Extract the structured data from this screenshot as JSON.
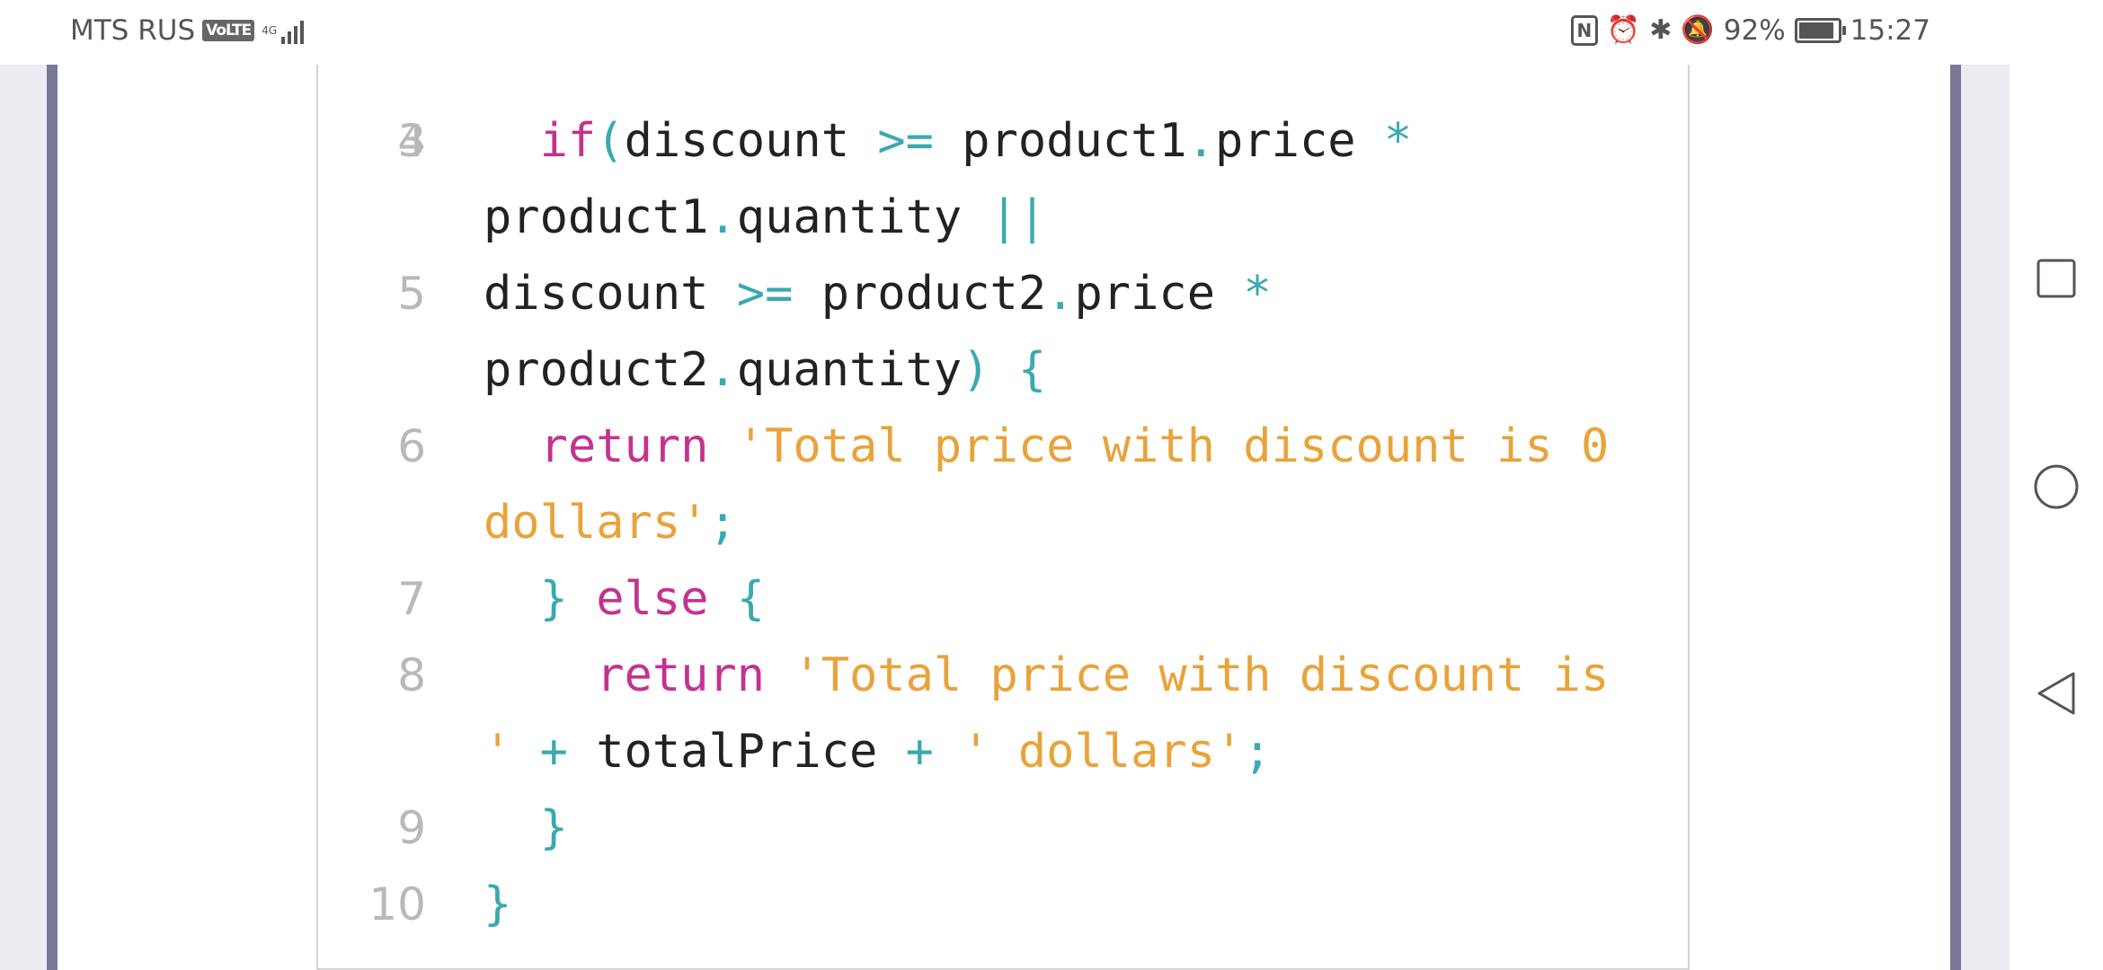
{
  "status_bar": {
    "carrier": "MTS RUS",
    "volte": "VoLTE",
    "network": "4G",
    "battery": "92%",
    "battery_level": 0.92,
    "time": "15:27"
  },
  "code": {
    "partial_line_number": "3",
    "lines": [
      {
        "num": "4",
        "tokens": [
          {
            "t": "  ",
            "c": "plain"
          },
          {
            "t": "if",
            "c": "kw"
          },
          {
            "t": "(",
            "c": "op"
          },
          {
            "t": "discount ",
            "c": "plain"
          },
          {
            "t": ">=",
            "c": "op"
          },
          {
            "t": " product1",
            "c": "plain"
          },
          {
            "t": ".",
            "c": "op"
          },
          {
            "t": "price ",
            "c": "plain"
          },
          {
            "t": "*",
            "c": "op"
          }
        ]
      },
      {
        "num": "",
        "tokens": [
          {
            "t": "product1",
            "c": "plain"
          },
          {
            "t": ".",
            "c": "op"
          },
          {
            "t": "quantity ",
            "c": "plain"
          },
          {
            "t": "||",
            "c": "op"
          }
        ]
      },
      {
        "num": "5",
        "tokens": [
          {
            "t": "discount ",
            "c": "plain"
          },
          {
            "t": ">=",
            "c": "op"
          },
          {
            "t": " product2",
            "c": "plain"
          },
          {
            "t": ".",
            "c": "op"
          },
          {
            "t": "price ",
            "c": "plain"
          },
          {
            "t": "*",
            "c": "op"
          }
        ]
      },
      {
        "num": "",
        "tokens": [
          {
            "t": "product2",
            "c": "plain"
          },
          {
            "t": ".",
            "c": "op"
          },
          {
            "t": "quantity",
            "c": "plain"
          },
          {
            "t": ")",
            "c": "op"
          },
          {
            "t": " ",
            "c": "plain"
          },
          {
            "t": "{",
            "c": "op"
          }
        ]
      },
      {
        "num": "6",
        "tokens": [
          {
            "t": "  ",
            "c": "plain"
          },
          {
            "t": "return",
            "c": "kw"
          },
          {
            "t": " ",
            "c": "plain"
          },
          {
            "t": "'Total price with discount is 0",
            "c": "str"
          }
        ]
      },
      {
        "num": "",
        "tokens": [
          {
            "t": "dollars'",
            "c": "str"
          },
          {
            "t": ";",
            "c": "op"
          }
        ]
      },
      {
        "num": "7",
        "tokens": [
          {
            "t": "  ",
            "c": "plain"
          },
          {
            "t": "}",
            "c": "op"
          },
          {
            "t": " ",
            "c": "plain"
          },
          {
            "t": "else",
            "c": "kw"
          },
          {
            "t": " ",
            "c": "plain"
          },
          {
            "t": "{",
            "c": "op"
          }
        ]
      },
      {
        "num": "8",
        "tokens": [
          {
            "t": "    ",
            "c": "plain"
          },
          {
            "t": "return",
            "c": "kw"
          },
          {
            "t": " ",
            "c": "plain"
          },
          {
            "t": "'Total price with discount is",
            "c": "str"
          }
        ]
      },
      {
        "num": "",
        "tokens": [
          {
            "t": "'",
            "c": "str"
          },
          {
            "t": " ",
            "c": "plain"
          },
          {
            "t": "+",
            "c": "op"
          },
          {
            "t": " totalPrice ",
            "c": "plain"
          },
          {
            "t": "+",
            "c": "op"
          },
          {
            "t": " ",
            "c": "plain"
          },
          {
            "t": "' dollars'",
            "c": "str"
          },
          {
            "t": ";",
            "c": "op"
          }
        ]
      },
      {
        "num": "9",
        "tokens": [
          {
            "t": "  ",
            "c": "plain"
          },
          {
            "t": "}",
            "c": "op"
          }
        ]
      },
      {
        "num": "10",
        "tokens": [
          {
            "t": "}",
            "c": "op"
          }
        ]
      }
    ]
  },
  "colors": {
    "keyword": "#c2338f",
    "operator": "#3aa9b0",
    "string": "#e8a33a",
    "text": "#222222",
    "line_number": "#b9b9b9",
    "frame": "#787896"
  },
  "nav_bar": {
    "recents_icon": "square-icon",
    "home_icon": "circle-icon",
    "back_icon": "triangle-back-icon"
  }
}
